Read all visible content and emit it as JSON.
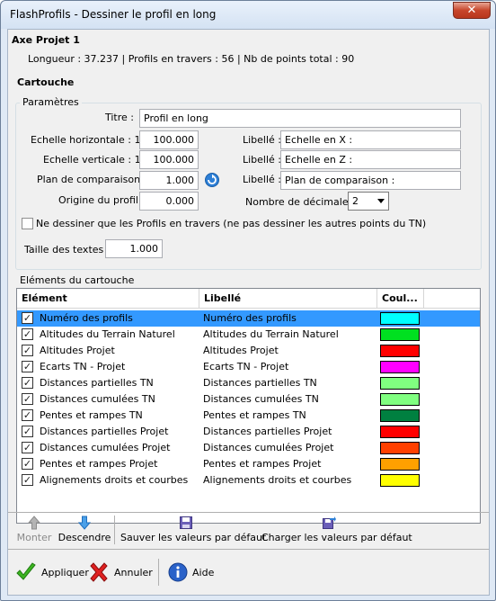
{
  "window": {
    "title": "FlashProfils - Dessiner le profil en long",
    "close_label": "✕"
  },
  "axe": {
    "heading": "Axe Projet 1",
    "summary": "Longueur : 37.237 | Profils en travers : 56 | Nb de points total : 90"
  },
  "cartouche": {
    "heading": "Cartouche"
  },
  "params": {
    "group_title": "Paramètres",
    "titre_label": "Titre :",
    "titre_value": "Profil en long",
    "echelle_h_label": "Echelle horizontale : 1 /",
    "echelle_h_value": "100.000",
    "echelle_v_label": "Echelle verticale : 1 /",
    "echelle_v_value": "100.000",
    "plan_label": "Plan de comparaison :",
    "plan_value": "1.000",
    "origine_label": "Origine du profil :",
    "origine_value": "0.000",
    "libelle_label": "Libellé :",
    "libelle_x_value": "Echelle en X :",
    "libelle_z_value": "Echelle en Z :",
    "libelle_plan_value": "Plan de comparaison :",
    "decimales_label": "Nombre de décimales :",
    "decimales_value": "2",
    "only_profils_label": "Ne dessiner que les Profils en travers (ne pas dessiner les autres points du TN)",
    "taille_label": "Taille des textes :",
    "taille_value": "1.000"
  },
  "elements": {
    "group_title": "Eléments du cartouche",
    "columns": [
      "Elément",
      "Libellé",
      "Coul..."
    ],
    "rows": [
      {
        "element": "Numéro des profils",
        "libelle": "Numéro des profils",
        "color": "#00ffff",
        "checked": true,
        "selected": true
      },
      {
        "element": "Altitudes du Terrain Naturel",
        "libelle": "Altitudes du Terrain Naturel",
        "color": "#00e020",
        "checked": true
      },
      {
        "element": "Altitudes Projet",
        "libelle": "Altitudes Projet",
        "color": "#ff0000",
        "checked": true
      },
      {
        "element": "Ecarts TN - Projet",
        "libelle": "Ecarts TN - Projet",
        "color": "#ff00ff",
        "checked": true
      },
      {
        "element": "Distances partielles TN",
        "libelle": "Distances partielles TN",
        "color": "#80ff80",
        "checked": true
      },
      {
        "element": "Distances cumulées TN",
        "libelle": "Distances cumulées TN",
        "color": "#80ff80",
        "checked": true
      },
      {
        "element": "Pentes et rampes TN",
        "libelle": "Pentes et rampes TN",
        "color": "#008040",
        "checked": true
      },
      {
        "element": "Distances partielles Projet",
        "libelle": "Distances partielles Projet",
        "color": "#ff0000",
        "checked": true
      },
      {
        "element": "Distances cumulées Projet",
        "libelle": "Distances cumulées Projet",
        "color": "#ff4000",
        "checked": true
      },
      {
        "element": "Pentes et rampes Projet",
        "libelle": "Pentes et rampes Projet",
        "color": "#ffa000",
        "checked": true
      },
      {
        "element": "Alignements droits et courbes",
        "libelle": "Alignements droits et courbes",
        "color": "#ffff00",
        "checked": true
      }
    ]
  },
  "toolbar": {
    "monter": "Monter",
    "descendre": "Descendre",
    "sauver": "Sauver les valeurs par défaut",
    "charger": "Charger les valeurs par défaut"
  },
  "footer": {
    "appliquer": "Appliquer",
    "annuler": "Annuler",
    "aide": "Aide"
  }
}
